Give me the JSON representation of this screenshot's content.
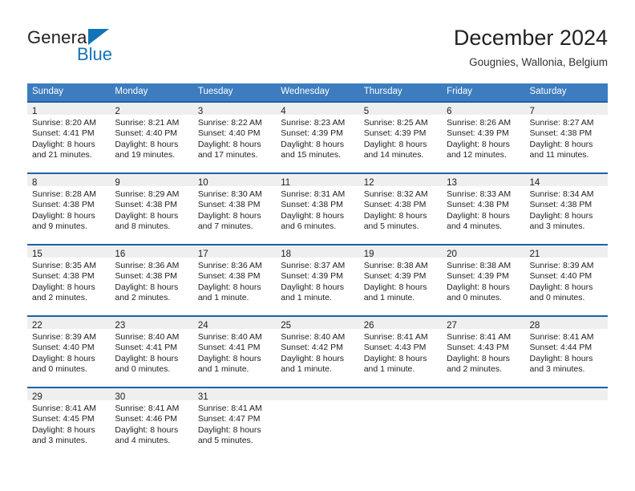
{
  "brand": {
    "name_part1": "General",
    "name_part2": "Blue",
    "triangle_color": "#1273b8"
  },
  "header": {
    "title": "December 2024",
    "subtitle": "Gougnies, Wallonia, Belgium"
  },
  "theme": {
    "header_blue": "#3c7cbf",
    "separator_blue": "#1e61a8",
    "daynum_band": "#efefef"
  },
  "weekdays": [
    "Sunday",
    "Monday",
    "Tuesday",
    "Wednesday",
    "Thursday",
    "Friday",
    "Saturday"
  ],
  "weeks": [
    [
      {
        "day": "1",
        "sunrise": "Sunrise: 8:20 AM",
        "sunset": "Sunset: 4:41 PM",
        "daylight1": "Daylight: 8 hours",
        "daylight2": "and 21 minutes."
      },
      {
        "day": "2",
        "sunrise": "Sunrise: 8:21 AM",
        "sunset": "Sunset: 4:40 PM",
        "daylight1": "Daylight: 8 hours",
        "daylight2": "and 19 minutes."
      },
      {
        "day": "3",
        "sunrise": "Sunrise: 8:22 AM",
        "sunset": "Sunset: 4:40 PM",
        "daylight1": "Daylight: 8 hours",
        "daylight2": "and 17 minutes."
      },
      {
        "day": "4",
        "sunrise": "Sunrise: 8:23 AM",
        "sunset": "Sunset: 4:39 PM",
        "daylight1": "Daylight: 8 hours",
        "daylight2": "and 15 minutes."
      },
      {
        "day": "5",
        "sunrise": "Sunrise: 8:25 AM",
        "sunset": "Sunset: 4:39 PM",
        "daylight1": "Daylight: 8 hours",
        "daylight2": "and 14 minutes."
      },
      {
        "day": "6",
        "sunrise": "Sunrise: 8:26 AM",
        "sunset": "Sunset: 4:39 PM",
        "daylight1": "Daylight: 8 hours",
        "daylight2": "and 12 minutes."
      },
      {
        "day": "7",
        "sunrise": "Sunrise: 8:27 AM",
        "sunset": "Sunset: 4:38 PM",
        "daylight1": "Daylight: 8 hours",
        "daylight2": "and 11 minutes."
      }
    ],
    [
      {
        "day": "8",
        "sunrise": "Sunrise: 8:28 AM",
        "sunset": "Sunset: 4:38 PM",
        "daylight1": "Daylight: 8 hours",
        "daylight2": "and 9 minutes."
      },
      {
        "day": "9",
        "sunrise": "Sunrise: 8:29 AM",
        "sunset": "Sunset: 4:38 PM",
        "daylight1": "Daylight: 8 hours",
        "daylight2": "and 8 minutes."
      },
      {
        "day": "10",
        "sunrise": "Sunrise: 8:30 AM",
        "sunset": "Sunset: 4:38 PM",
        "daylight1": "Daylight: 8 hours",
        "daylight2": "and 7 minutes."
      },
      {
        "day": "11",
        "sunrise": "Sunrise: 8:31 AM",
        "sunset": "Sunset: 4:38 PM",
        "daylight1": "Daylight: 8 hours",
        "daylight2": "and 6 minutes."
      },
      {
        "day": "12",
        "sunrise": "Sunrise: 8:32 AM",
        "sunset": "Sunset: 4:38 PM",
        "daylight1": "Daylight: 8 hours",
        "daylight2": "and 5 minutes."
      },
      {
        "day": "13",
        "sunrise": "Sunrise: 8:33 AM",
        "sunset": "Sunset: 4:38 PM",
        "daylight1": "Daylight: 8 hours",
        "daylight2": "and 4 minutes."
      },
      {
        "day": "14",
        "sunrise": "Sunrise: 8:34 AM",
        "sunset": "Sunset: 4:38 PM",
        "daylight1": "Daylight: 8 hours",
        "daylight2": "and 3 minutes."
      }
    ],
    [
      {
        "day": "15",
        "sunrise": "Sunrise: 8:35 AM",
        "sunset": "Sunset: 4:38 PM",
        "daylight1": "Daylight: 8 hours",
        "daylight2": "and 2 minutes."
      },
      {
        "day": "16",
        "sunrise": "Sunrise: 8:36 AM",
        "sunset": "Sunset: 4:38 PM",
        "daylight1": "Daylight: 8 hours",
        "daylight2": "and 2 minutes."
      },
      {
        "day": "17",
        "sunrise": "Sunrise: 8:36 AM",
        "sunset": "Sunset: 4:38 PM",
        "daylight1": "Daylight: 8 hours",
        "daylight2": "and 1 minute."
      },
      {
        "day": "18",
        "sunrise": "Sunrise: 8:37 AM",
        "sunset": "Sunset: 4:39 PM",
        "daylight1": "Daylight: 8 hours",
        "daylight2": "and 1 minute."
      },
      {
        "day": "19",
        "sunrise": "Sunrise: 8:38 AM",
        "sunset": "Sunset: 4:39 PM",
        "daylight1": "Daylight: 8 hours",
        "daylight2": "and 1 minute."
      },
      {
        "day": "20",
        "sunrise": "Sunrise: 8:38 AM",
        "sunset": "Sunset: 4:39 PM",
        "daylight1": "Daylight: 8 hours",
        "daylight2": "and 0 minutes."
      },
      {
        "day": "21",
        "sunrise": "Sunrise: 8:39 AM",
        "sunset": "Sunset: 4:40 PM",
        "daylight1": "Daylight: 8 hours",
        "daylight2": "and 0 minutes."
      }
    ],
    [
      {
        "day": "22",
        "sunrise": "Sunrise: 8:39 AM",
        "sunset": "Sunset: 4:40 PM",
        "daylight1": "Daylight: 8 hours",
        "daylight2": "and 0 minutes."
      },
      {
        "day": "23",
        "sunrise": "Sunrise: 8:40 AM",
        "sunset": "Sunset: 4:41 PM",
        "daylight1": "Daylight: 8 hours",
        "daylight2": "and 0 minutes."
      },
      {
        "day": "24",
        "sunrise": "Sunrise: 8:40 AM",
        "sunset": "Sunset: 4:41 PM",
        "daylight1": "Daylight: 8 hours",
        "daylight2": "and 1 minute."
      },
      {
        "day": "25",
        "sunrise": "Sunrise: 8:40 AM",
        "sunset": "Sunset: 4:42 PM",
        "daylight1": "Daylight: 8 hours",
        "daylight2": "and 1 minute."
      },
      {
        "day": "26",
        "sunrise": "Sunrise: 8:41 AM",
        "sunset": "Sunset: 4:43 PM",
        "daylight1": "Daylight: 8 hours",
        "daylight2": "and 1 minute."
      },
      {
        "day": "27",
        "sunrise": "Sunrise: 8:41 AM",
        "sunset": "Sunset: 4:43 PM",
        "daylight1": "Daylight: 8 hours",
        "daylight2": "and 2 minutes."
      },
      {
        "day": "28",
        "sunrise": "Sunrise: 8:41 AM",
        "sunset": "Sunset: 4:44 PM",
        "daylight1": "Daylight: 8 hours",
        "daylight2": "and 3 minutes."
      }
    ],
    [
      {
        "day": "29",
        "sunrise": "Sunrise: 8:41 AM",
        "sunset": "Sunset: 4:45 PM",
        "daylight1": "Daylight: 8 hours",
        "daylight2": "and 3 minutes."
      },
      {
        "day": "30",
        "sunrise": "Sunrise: 8:41 AM",
        "sunset": "Sunset: 4:46 PM",
        "daylight1": "Daylight: 8 hours",
        "daylight2": "and 4 minutes."
      },
      {
        "day": "31",
        "sunrise": "Sunrise: 8:41 AM",
        "sunset": "Sunset: 4:47 PM",
        "daylight1": "Daylight: 8 hours",
        "daylight2": "and 5 minutes."
      },
      {
        "day": "",
        "sunrise": "",
        "sunset": "",
        "daylight1": "",
        "daylight2": ""
      },
      {
        "day": "",
        "sunrise": "",
        "sunset": "",
        "daylight1": "",
        "daylight2": ""
      },
      {
        "day": "",
        "sunrise": "",
        "sunset": "",
        "daylight1": "",
        "daylight2": ""
      },
      {
        "day": "",
        "sunrise": "",
        "sunset": "",
        "daylight1": "",
        "daylight2": ""
      }
    ]
  ]
}
